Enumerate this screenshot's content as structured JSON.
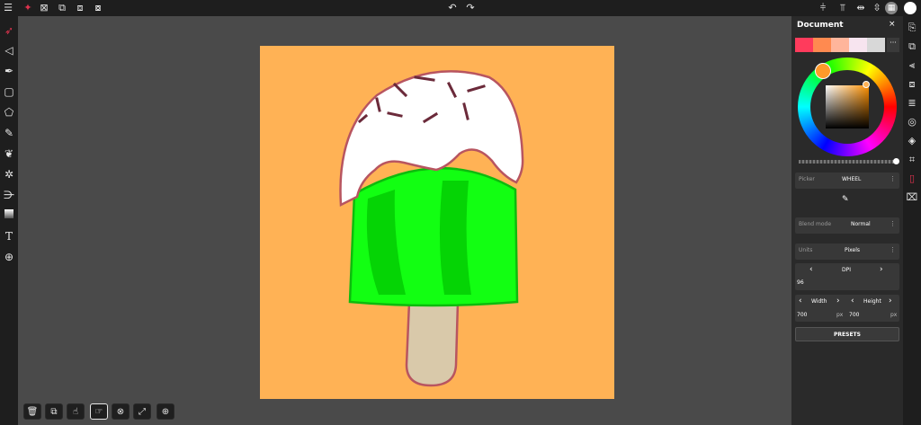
{
  "top_toolbar": {
    "menu_icon": "menu-icon",
    "undo_icon": "undo-icon",
    "redo_icon": "redo-icon"
  },
  "panel": {
    "title": "Document",
    "close": "×",
    "swatches": [
      "#ff3b5c",
      "#ff8a50",
      "#ffb59b",
      "#f7e4ef",
      "#d8d8d8"
    ],
    "more": "···",
    "picker_label": "Picker",
    "picker_value": "WHEEL",
    "blend_label": "Blend mode",
    "blend_value": "Normal",
    "units_label": "Units",
    "units_value": "Pixels",
    "dpi_label": "DPI",
    "dpi_value": "96",
    "width_label": "Width",
    "height_label": "Height",
    "width_value": "700",
    "height_value": "700",
    "unit_px": "px",
    "presets_label": "PRESETS"
  },
  "colors": {
    "canvas_bg": "#ffb255",
    "popsicle_green": "#12ff12",
    "popsicle_dark": "#05d405",
    "icing": "#ffffff",
    "outline": "#b85560",
    "stick": "#d9c9aa",
    "sprinkle": "#6b2a3a"
  }
}
